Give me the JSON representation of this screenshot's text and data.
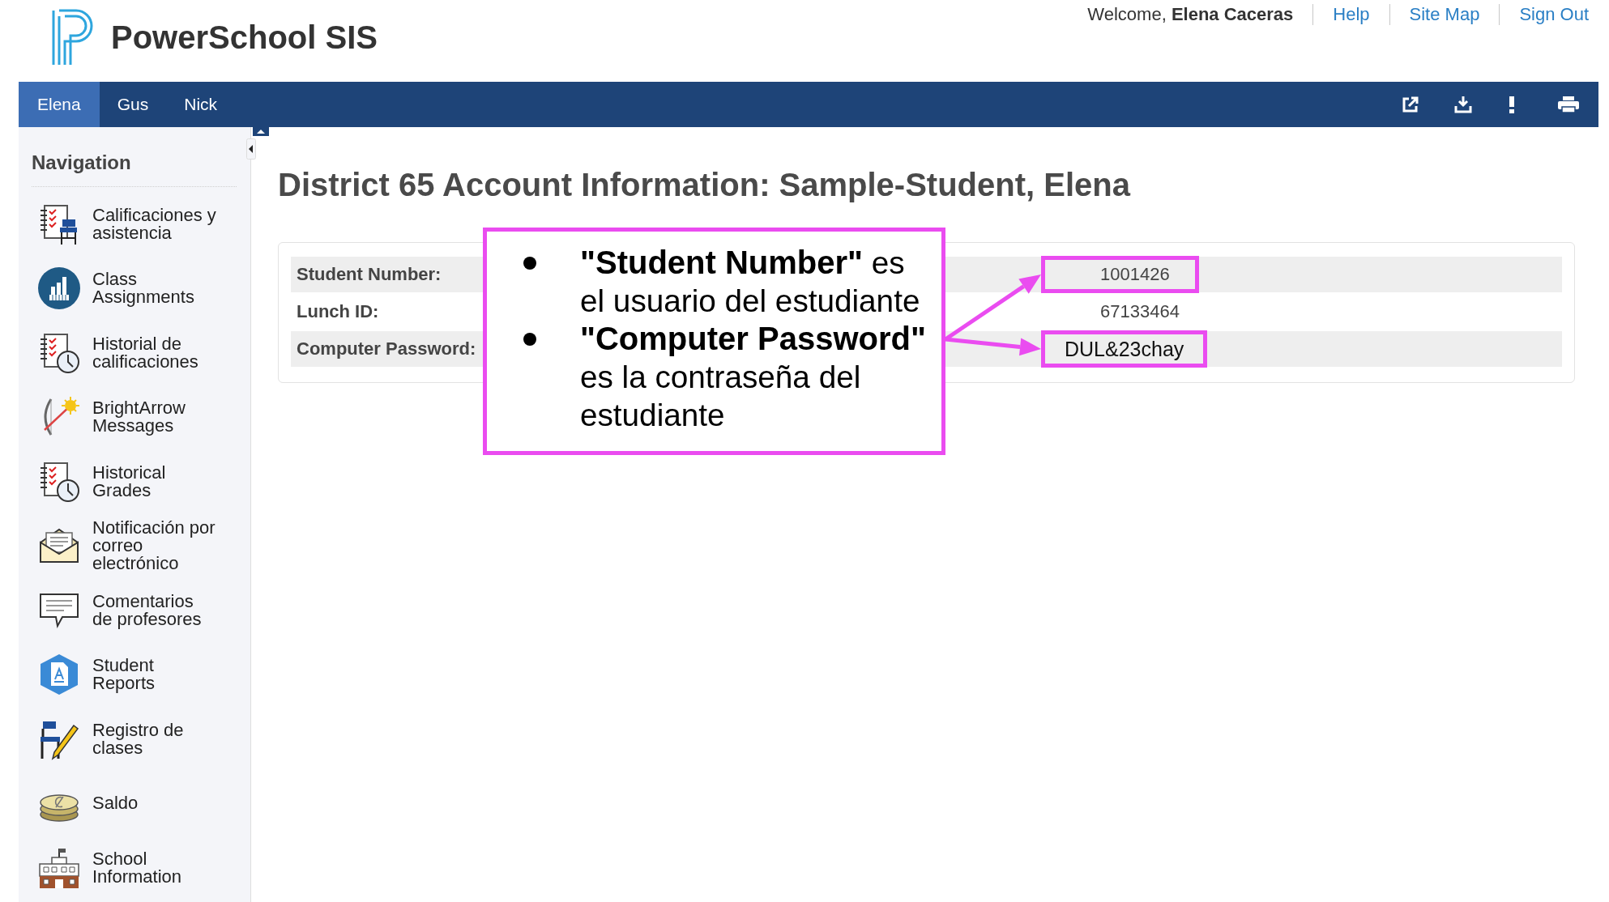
{
  "header": {
    "brand": "PowerSchool SIS",
    "welcome": "Welcome, **Elena Caceras**",
    "links": [
      "Help",
      "Site Map",
      "Sign Out"
    ]
  },
  "student_tabs": [
    {
      "label": "Elena",
      "selected": true
    },
    {
      "label": "Gus",
      "selected": false
    },
    {
      "label": "Nick",
      "selected": false
    }
  ],
  "sidebar": {
    "title": "Navigation",
    "items": [
      "Calificaciones y asistencia",
      "Class Assignments",
      "Historial de calificaciones",
      "BrightArrow Messages",
      "Historical Grades",
      "Notificación por correo electrónico",
      "Comentarios de profesores",
      "Student Reports",
      "Registro de clases",
      "Saldo",
      "School Information"
    ]
  },
  "page_title": "District 65 Account Information: Sample-Student, Elena",
  "account_table": {
    "rows": [
      {
        "label": "Student Number:",
        "value": "1001426",
        "highlighted": true,
        "emphasized": false
      },
      {
        "label": "Lunch ID:",
        "value": "67133464",
        "highlighted": false,
        "emphasized": false
      },
      {
        "label": "Computer Password:",
        "value": "DUL&23chay",
        "highlighted": true,
        "emphasized": true
      }
    ]
  },
  "callout": {
    "items": [
      "**\"Student Number\"** es el usuario del estudiante",
      "**\"Computer Password\"** es la contraseña del estudiante"
    ]
  }
}
